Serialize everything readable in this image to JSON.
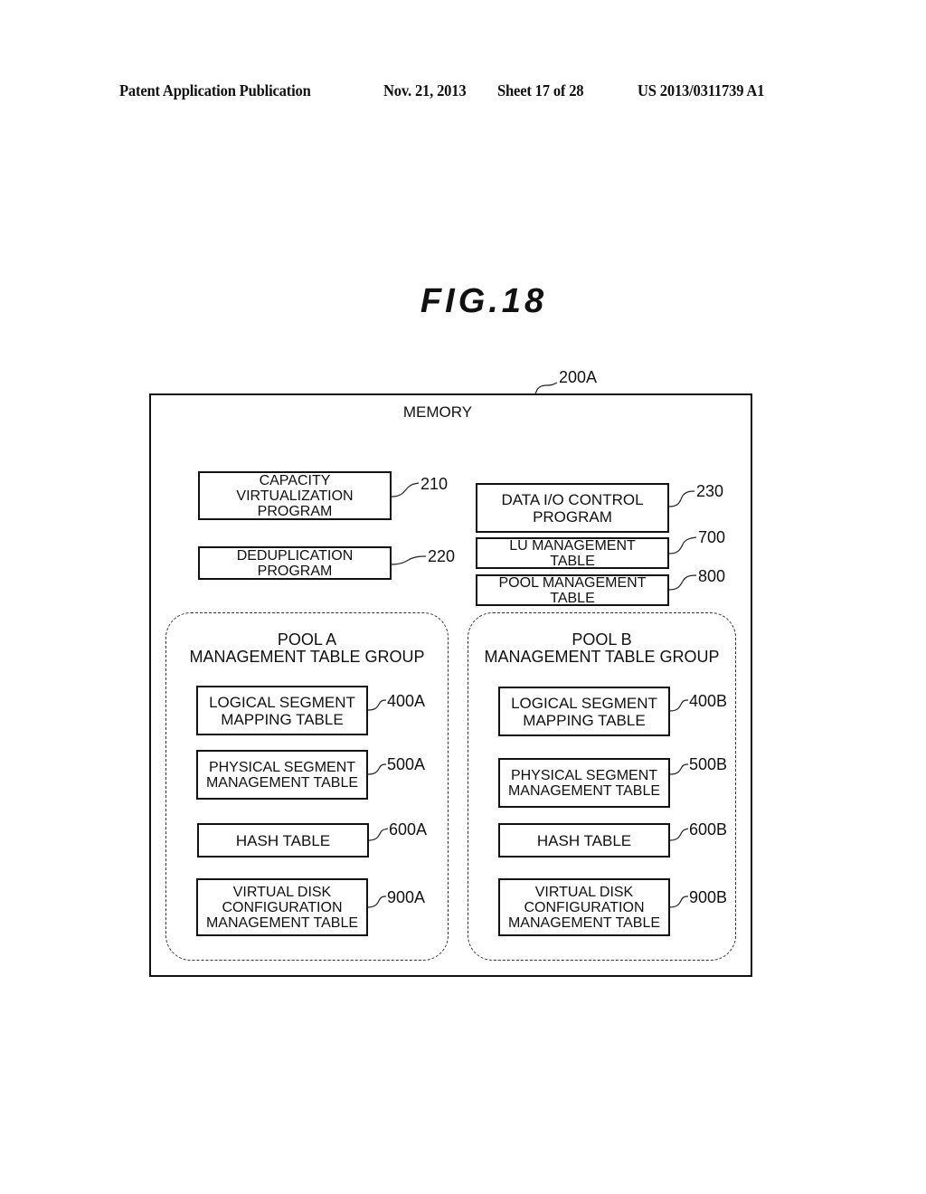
{
  "header": {
    "publication": "Patent Application Publication",
    "date": "Nov. 21, 2013",
    "sheet": "Sheet 17 of 28",
    "number": "US 2013/0311739 A1"
  },
  "figure": {
    "title": "FIG.18"
  },
  "memory": {
    "ref": "200A",
    "label": "MEMORY",
    "programs": [
      {
        "label": "CAPACITY\nVIRTUALIZATION\nPROGRAM",
        "ref": "210"
      },
      {
        "label": "DEDUPLICATION\nPROGRAM",
        "ref": "220"
      },
      {
        "label": "DATA I/O CONTROL\nPROGRAM",
        "ref": "230"
      },
      {
        "label": "LU MANAGEMENT\nTABLE",
        "ref": "700"
      },
      {
        "label": "POOL MANAGEMENT\nTABLE",
        "ref": "800"
      }
    ],
    "groups": [
      {
        "title": "POOL A\nMANAGEMENT TABLE GROUP",
        "tables": [
          {
            "label": "LOGICAL SEGMENT\nMAPPING TABLE",
            "ref": "400A"
          },
          {
            "label": "PHYSICAL SEGMENT\nMANAGEMENT TABLE",
            "ref": "500A"
          },
          {
            "label": "HASH TABLE",
            "ref": "600A"
          },
          {
            "label": "VIRTUAL DISK\nCONFIGURATION\nMANAGEMENT TABLE",
            "ref": "900A"
          }
        ]
      },
      {
        "title": "POOL B\nMANAGEMENT TABLE GROUP",
        "tables": [
          {
            "label": "LOGICAL SEGMENT\nMAPPING TABLE",
            "ref": "400B"
          },
          {
            "label": "PHYSICAL SEGMENT\nMANAGEMENT TABLE",
            "ref": "500B"
          },
          {
            "label": "HASH TABLE",
            "ref": "600B"
          },
          {
            "label": "VIRTUAL DISK\nCONFIGURATION\nMANAGEMENT TABLE",
            "ref": "900B"
          }
        ]
      }
    ]
  }
}
